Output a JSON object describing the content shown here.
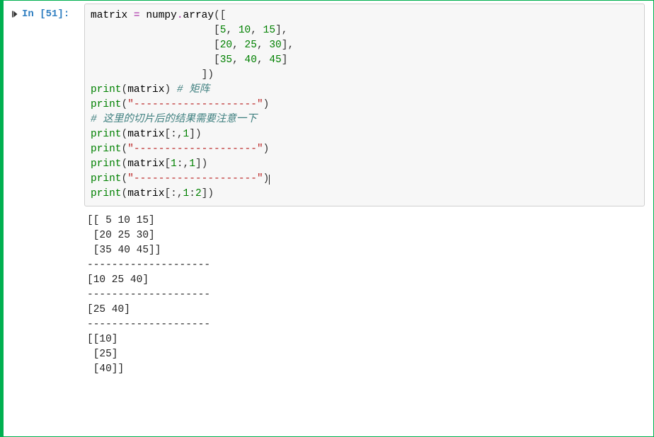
{
  "prompt": {
    "label": "In ",
    "exec": "[51]",
    "colon": ":"
  },
  "code": {
    "l1": {
      "name": "matrix",
      "eq": " = ",
      "mod": "numpy",
      "dot": ".",
      "call": "array",
      "open": "(["
    },
    "pad": "                    ",
    "rows": [
      {
        "open": "[",
        "a": "5",
        "c1": ", ",
        "b": "10",
        "c2": ", ",
        "c": "15",
        "close": "],"
      },
      {
        "open": "[",
        "a": "20",
        "c1": ", ",
        "b": "25",
        "c2": ", ",
        "c": "30",
        "close": "],"
      },
      {
        "open": "[",
        "a": "35",
        "c1": ", ",
        "b": "40",
        "c2": ", ",
        "c": "45",
        "close": "]"
      }
    ],
    "close_outer_pad": "                  ",
    "close_outer": "])",
    "p1": {
      "fn": "print",
      "open": "(",
      "arg": "matrix",
      "close": ")",
      "sp": " ",
      "cm": "# 矩阵"
    },
    "sep1": {
      "fn": "print",
      "open": "(",
      "q1": "\"",
      "dash": "--------------------",
      "q2": "\"",
      "close": ")"
    },
    "cm1": "# 这里的切片后的结果需要注意一下",
    "p2": {
      "fn": "print",
      "open": "(",
      "name": "matrix",
      "br": "[:,",
      "idx": "1",
      "close": "])"
    },
    "sep2": {
      "fn": "print",
      "open": "(",
      "q1": "\"",
      "dash": "--------------------",
      "q2": "\"",
      "close": ")"
    },
    "p3": {
      "fn": "print",
      "open": "(",
      "name": "matrix",
      "br": "[",
      "a": "1",
      "mid": ":,",
      "b": "1",
      "close": "])"
    },
    "sep3": {
      "fn": "print",
      "open": "(",
      "q1": "\"",
      "dash": "--------------------",
      "q2": "\"",
      "close": ")"
    },
    "p4": {
      "fn": "print",
      "open": "(",
      "name": "matrix",
      "br": "[:,",
      "a": "1",
      "mid": ":",
      "b": "2",
      "close": "])"
    }
  },
  "output": "[[ 5 10 15]\n [20 25 30]\n [35 40 45]]\n--------------------\n[10 25 40]\n--------------------\n[25 40]\n--------------------\n[[10]\n [25]\n [40]]"
}
